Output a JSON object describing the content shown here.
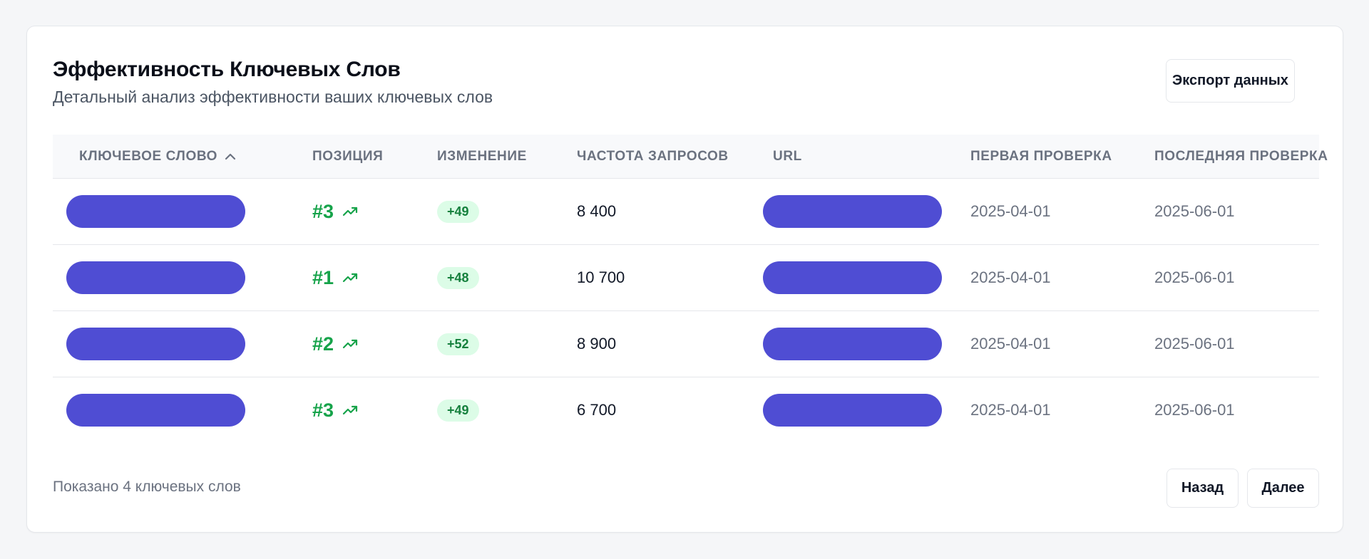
{
  "header": {
    "title": "Эффективность Ключевых Слов",
    "subtitle": "Детальный анализ эффективности ваших ключевых слов",
    "export_label": "Экспорт данных"
  },
  "table": {
    "columns": {
      "keyword": "КЛЮЧЕВОЕ СЛОВО",
      "position": "ПОЗИЦИЯ",
      "change": "ИЗМЕНЕНИЕ",
      "frequency": "ЧАСТОТА ЗАПРОСОВ",
      "url": "URL",
      "first_check": "ПЕРВАЯ ПРОВЕРКА",
      "last_check": "ПОСЛЕДНЯЯ ПРОВЕРКА"
    },
    "sort_icon": "chevron-up-icon",
    "trend_icon": "trending-up-icon",
    "rows": [
      {
        "position": "#3",
        "change": "+49",
        "frequency": "8 400",
        "first_check": "2025-04-01",
        "last_check": "2025-06-01"
      },
      {
        "position": "#1",
        "change": "+48",
        "frequency": "10 700",
        "first_check": "2025-04-01",
        "last_check": "2025-06-01"
      },
      {
        "position": "#2",
        "change": "+52",
        "frequency": "8 900",
        "first_check": "2025-04-01",
        "last_check": "2025-06-01"
      },
      {
        "position": "#3",
        "change": "+49",
        "frequency": "6 700",
        "first_check": "2025-04-01",
        "last_check": "2025-06-01"
      }
    ]
  },
  "footer": {
    "summary": "Показано 4 ключевых слов",
    "back_label": "Назад",
    "next_label": "Далее"
  },
  "colors": {
    "redaction": "#4f4dd3",
    "positive": "#16a34a",
    "badge_bg": "#dcfce7"
  }
}
